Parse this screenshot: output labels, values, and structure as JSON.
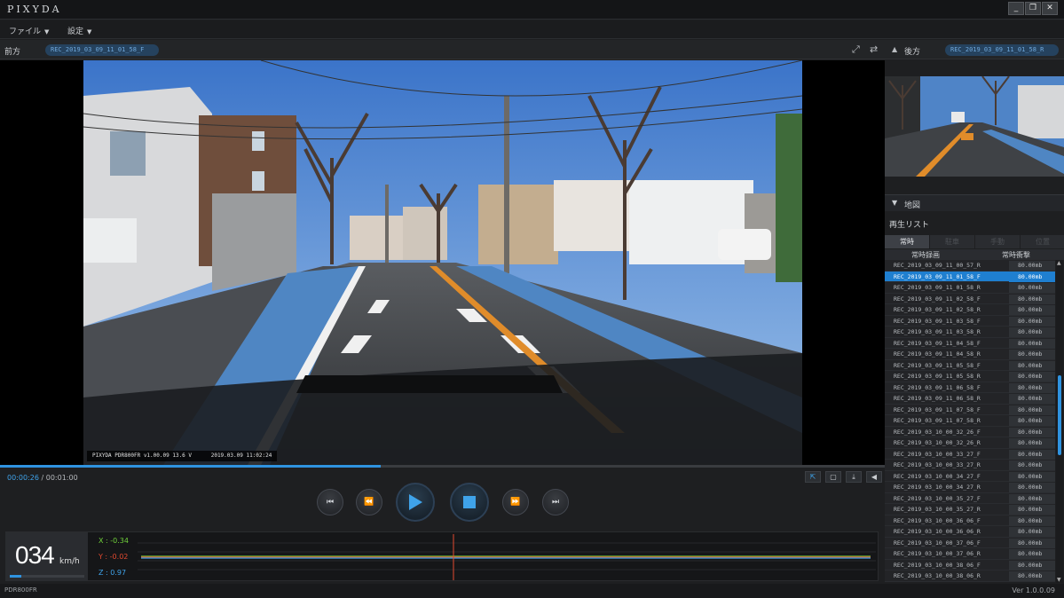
{
  "app": {
    "title": "PIXYDA"
  },
  "window_controls": {
    "minimize": "_",
    "maximize": "❐",
    "close": "✕"
  },
  "menu": [
    {
      "label": "ファイル"
    },
    {
      "label": "設定"
    }
  ],
  "front": {
    "label": "前方",
    "file": "REC_2019_03_09_11_01_58_F"
  },
  "rear": {
    "label": "後方",
    "file": "REC_2019_03_09_11_01_58_R"
  },
  "overlay": {
    "device": "PIXYDA PDR800FR",
    "version": "v1.00.09",
    "voltage": "13.6 V",
    "datetime": "2019.03.09 11:02:24"
  },
  "playback": {
    "current": "00:00:26",
    "separator": "/",
    "total": "00:01:00",
    "progress_fraction": 0.43
  },
  "speed": {
    "value": "034",
    "unit": "km/h",
    "gauge_fraction": 0.15
  },
  "accel": {
    "x": "X : -0.34",
    "y": "Y : -0.02",
    "z": "Z : 0.97",
    "colors": {
      "x": "#6fcf3a",
      "y": "#e2492f",
      "z": "#3fa3ea"
    }
  },
  "map": {
    "label": "地図"
  },
  "playlist": {
    "title": "再生リスト",
    "tabs": [
      "常時",
      "駐車",
      "手動",
      "位置"
    ],
    "col_file": "常時録画",
    "col_size": "常時衝撃",
    "items": [
      {
        "name": "REC_2019_03_09_11_00_57_R",
        "size": "80.00mb"
      },
      {
        "name": "REC_2019_03_09_11_01_58_F",
        "size": "80.00mb",
        "selected": true
      },
      {
        "name": "REC_2019_03_09_11_01_58_R",
        "size": "80.00mb"
      },
      {
        "name": "REC_2019_03_09_11_02_58_F",
        "size": "80.00mb"
      },
      {
        "name": "REC_2019_03_09_11_02_58_R",
        "size": "80.00mb"
      },
      {
        "name": "REC_2019_03_09_11_03_58_F",
        "size": "80.00mb"
      },
      {
        "name": "REC_2019_03_09_11_03_58_R",
        "size": "80.00mb"
      },
      {
        "name": "REC_2019_03_09_11_04_58_F",
        "size": "80.00mb"
      },
      {
        "name": "REC_2019_03_09_11_04_58_R",
        "size": "80.00mb"
      },
      {
        "name": "REC_2019_03_09_11_05_58_F",
        "size": "80.00mb"
      },
      {
        "name": "REC_2019_03_09_11_05_58_R",
        "size": "80.00mb"
      },
      {
        "name": "REC_2019_03_09_11_06_58_F",
        "size": "80.00mb"
      },
      {
        "name": "REC_2019_03_09_11_06_58_R",
        "size": "80.00mb"
      },
      {
        "name": "REC_2019_03_09_11_07_58_F",
        "size": "80.00mb"
      },
      {
        "name": "REC_2019_03_09_11_07_58_R",
        "size": "80.00mb"
      },
      {
        "name": "REC_2019_03_10_00_32_26_F",
        "size": "80.00mb"
      },
      {
        "name": "REC_2019_03_10_00_32_26_R",
        "size": "80.00mb"
      },
      {
        "name": "REC_2019_03_10_00_33_27_F",
        "size": "80.00mb"
      },
      {
        "name": "REC_2019_03_10_00_33_27_R",
        "size": "80.00mb"
      },
      {
        "name": "REC_2019_03_10_00_34_27_F",
        "size": "80.00mb"
      },
      {
        "name": "REC_2019_03_10_00_34_27_R",
        "size": "80.00mb"
      },
      {
        "name": "REC_2019_03_10_00_35_27_F",
        "size": "80.00mb"
      },
      {
        "name": "REC_2019_03_10_00_35_27_R",
        "size": "80.00mb"
      },
      {
        "name": "REC_2019_03_10_00_36_06_F",
        "size": "80.00mb"
      },
      {
        "name": "REC_2019_03_10_00_36_06_R",
        "size": "80.00mb"
      },
      {
        "name": "REC_2019_03_10_00_37_06_F",
        "size": "80.00mb"
      },
      {
        "name": "REC_2019_03_10_00_37_06_R",
        "size": "80.00mb"
      },
      {
        "name": "REC_2019_03_10_00_38_06_F",
        "size": "80.00mb"
      },
      {
        "name": "REC_2019_03_10_00_38_06_R",
        "size": "80.00mb"
      }
    ]
  },
  "status": {
    "model": "PDR800FR",
    "version": "Ver 1.0.0.09"
  },
  "colors": {
    "accent": "#2f93e0",
    "selected_row": "#1f7fd0",
    "pill_text": "#6fa8dc"
  }
}
